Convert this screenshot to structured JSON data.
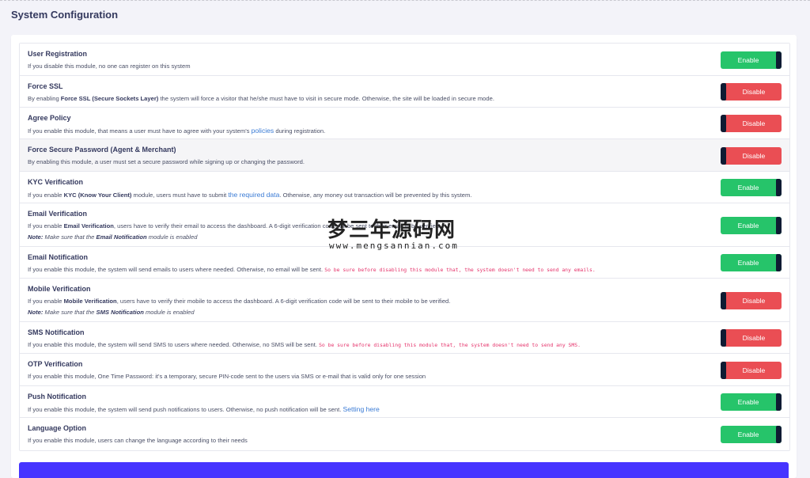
{
  "page": {
    "title": "System Configuration"
  },
  "modules": [
    {
      "title": "User Registration",
      "desc_parts": [
        {
          "t": "If you disable this module, no one can register on this system"
        }
      ],
      "status": "Enable"
    },
    {
      "title": "Force SSL",
      "desc_parts": [
        {
          "t": "By enabling "
        },
        {
          "t": "Force SSL (Secure Sockets Layer)",
          "b": true
        },
        {
          "t": " the system will force a visitor that he/she must have to visit in secure mode. Otherwise, the site will be loaded in secure mode."
        }
      ],
      "status": "Disable"
    },
    {
      "title": "Agree Policy",
      "desc_parts": [
        {
          "t": "If you enable this module, that means a user must have to agree with your system's "
        },
        {
          "t": "policies",
          "link": true
        },
        {
          "t": " during registration."
        }
      ],
      "status": "Disable"
    },
    {
      "title": "Force Secure Password (Agent & Merchant)",
      "desc_parts": [
        {
          "t": "By enabling this module, a user must set a secure password while signing up or changing the password."
        }
      ],
      "status": "Disable"
    },
    {
      "title": "KYC Verification",
      "desc_parts": [
        {
          "t": "If you enable "
        },
        {
          "t": "KYC (Know Your Client)",
          "b": true
        },
        {
          "t": " module, users must have to submit "
        },
        {
          "t": "the required data",
          "link": true
        },
        {
          "t": ". Otherwise, any money out transaction will be prevented by this system."
        }
      ],
      "status": "Enable"
    },
    {
      "title": "Email Verification",
      "desc_parts": [
        {
          "t": "If you enable "
        },
        {
          "t": "Email Verification",
          "b": true
        },
        {
          "t": ", users have to verify their email to access the dashboard. A 6-digit verification code will be sent to their email to be verified."
        }
      ],
      "note_parts": [
        {
          "t": "Note:",
          "b": true
        },
        {
          "t": " Make sure that the "
        },
        {
          "t": "Email Notification",
          "b": true
        },
        {
          "t": " module is enabled"
        }
      ],
      "status": "Enable"
    },
    {
      "title": "Email Notification",
      "desc_parts": [
        {
          "t": "If you enable this module, the system will send emails to users where needed. Otherwise, no email will be sent. "
        },
        {
          "t": "So be sure before disabling this module that, the system doesn't need to send any emails.",
          "code": true
        }
      ],
      "status": "Enable"
    },
    {
      "title": "Mobile Verification",
      "desc_parts": [
        {
          "t": "If you enable "
        },
        {
          "t": "Mobile Verification",
          "b": true
        },
        {
          "t": ", users have to verify their mobile to access the dashboard. A 6-digit verification code will be sent to their mobile to be verified."
        }
      ],
      "note_parts": [
        {
          "t": "Note:",
          "b": true
        },
        {
          "t": " Make sure that the "
        },
        {
          "t": "SMS Notification",
          "b": true
        },
        {
          "t": " module is enabled"
        }
      ],
      "status": "Disable"
    },
    {
      "title": "SMS Notification",
      "desc_parts": [
        {
          "t": "If you enable this module, the system will send SMS to users where needed. Otherwise, no SMS will be sent. "
        },
        {
          "t": "So be sure before disabling this module that, the system doesn't need to send any SMS.",
          "code": true
        }
      ],
      "status": "Disable"
    },
    {
      "title": "OTP Verification",
      "desc_parts": [
        {
          "t": "If you enable this module, One Time Password: it's a temporary, secure PIN-code sent to the users via SMS or e-mail that is valid only for one session"
        }
      ],
      "status": "Disable"
    },
    {
      "title": "Push Notification",
      "desc_parts": [
        {
          "t": "If you enable this module, the system will send push notifications to users. Otherwise, no push notification will be sent. "
        },
        {
          "t": "Setting here",
          "link": true
        }
      ],
      "status": "Enable"
    },
    {
      "title": "Language Option",
      "desc_parts": [
        {
          "t": "If you enable this module, users can change the language according to their needs"
        }
      ],
      "status": "Enable"
    }
  ],
  "watermark": {
    "text_cn": "梦三年源码网",
    "url": "www.mengsannian.com"
  },
  "colors": {
    "enable": "#26c46a",
    "disable": "#ea4e54",
    "knob": "#0f1b33",
    "link": "#3a7bd5",
    "warn": "#e5336b",
    "submit": "#4634ff"
  }
}
